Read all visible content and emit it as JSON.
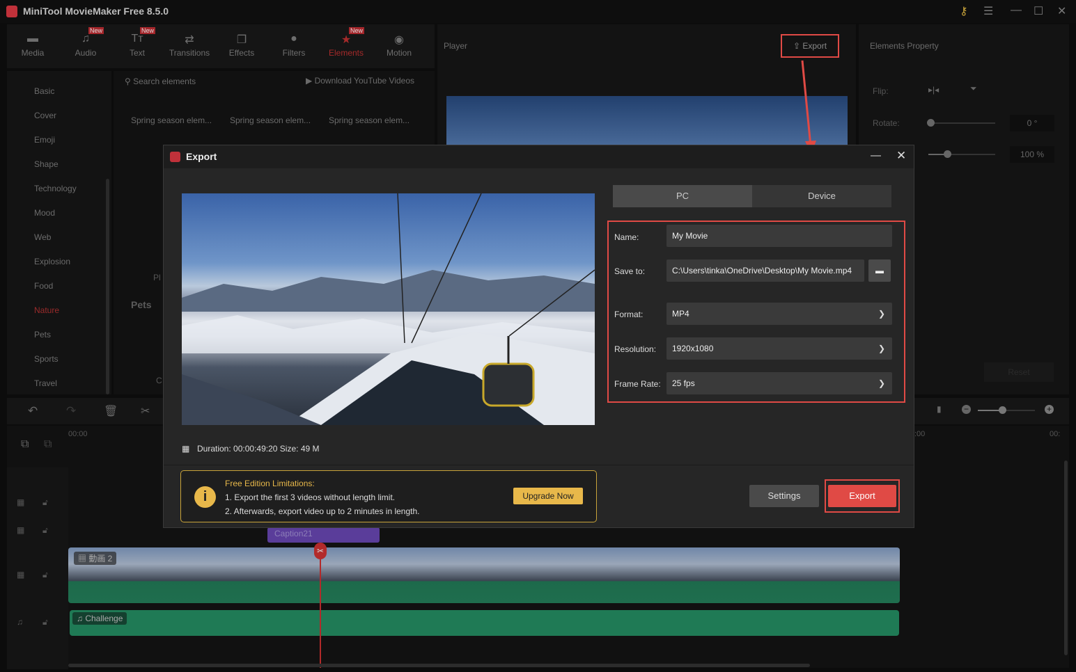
{
  "app": {
    "title": "MiniTool MovieMaker Free 8.5.0"
  },
  "toolbar": {
    "items": [
      {
        "label": "Media",
        "icon": "folder-icon"
      },
      {
        "label": "Audio",
        "icon": "music-icon",
        "badge": "New"
      },
      {
        "label": "Text",
        "icon": "text-icon",
        "badge": "New"
      },
      {
        "label": "Transitions",
        "icon": "transitions-icon"
      },
      {
        "label": "Effects",
        "icon": "effects-icon"
      },
      {
        "label": "Filters",
        "icon": "filters-icon"
      },
      {
        "label": "Elements",
        "icon": "elements-icon",
        "badge": "New",
        "active": true
      },
      {
        "label": "Motion",
        "icon": "motion-icon"
      }
    ]
  },
  "categories": [
    "Basic",
    "Cover",
    "Emoji",
    "Shape",
    "Technology",
    "Mood",
    "Web",
    "Explosion",
    "Food",
    "Nature",
    "Pets",
    "Sports",
    "Travel"
  ],
  "active_category": "Nature",
  "elements": {
    "search_placeholder": "Search elements",
    "download_label": "Download YouTube Videos",
    "items": [
      "Spring season elem...",
      "Spring season elem...",
      "Spring season elem..."
    ],
    "section_pets": "Pets",
    "partial1": "Pl",
    "partial2": "C"
  },
  "player": {
    "title": "Player",
    "export_label": "Export"
  },
  "property": {
    "title": "Elements Property",
    "flip_label": "Flip:",
    "rotate_label": "Rotate:",
    "rotate_value": "0 °",
    "scale_value": "100 %",
    "rotate_fraction": 0,
    "scale_fraction": 0.25,
    "reset_label": "Reset"
  },
  "timeline": {
    "time_start": "00:00",
    "time_mid": ":00",
    "time_end": "00:",
    "zoom_fraction": 0.4,
    "caption_clip": "Caption21",
    "video_clip": "動画 2",
    "audio_clip": "Challenge"
  },
  "dialog": {
    "title": "Export",
    "tabs": [
      "PC",
      "Device"
    ],
    "active_tab": "PC",
    "name_label": "Name:",
    "name_value": "My Movie",
    "save_label": "Save to:",
    "save_value": "C:\\Users\\tinka\\OneDrive\\Desktop\\My Movie.mp4",
    "format_label": "Format:",
    "format_value": "MP4",
    "resolution_label": "Resolution:",
    "resolution_value": "1920x1080",
    "framerate_label": "Frame Rate:",
    "framerate_value": "25 fps",
    "duration_label": "Duration:",
    "duration_value": "00:00:49:20",
    "size_label": "Size:",
    "size_value": "49 M",
    "limit_title": "Free Edition Limitations:",
    "limit_1": "1. Export the first 3 videos without length limit.",
    "limit_2": "2. Afterwards, export video up to 2 minutes in length.",
    "upgrade_label": "Upgrade Now",
    "settings_label": "Settings",
    "export_label": "Export"
  },
  "colors": {
    "accent": "#e04a45",
    "warning": "#c9a43a",
    "active": "#a52a2a"
  }
}
